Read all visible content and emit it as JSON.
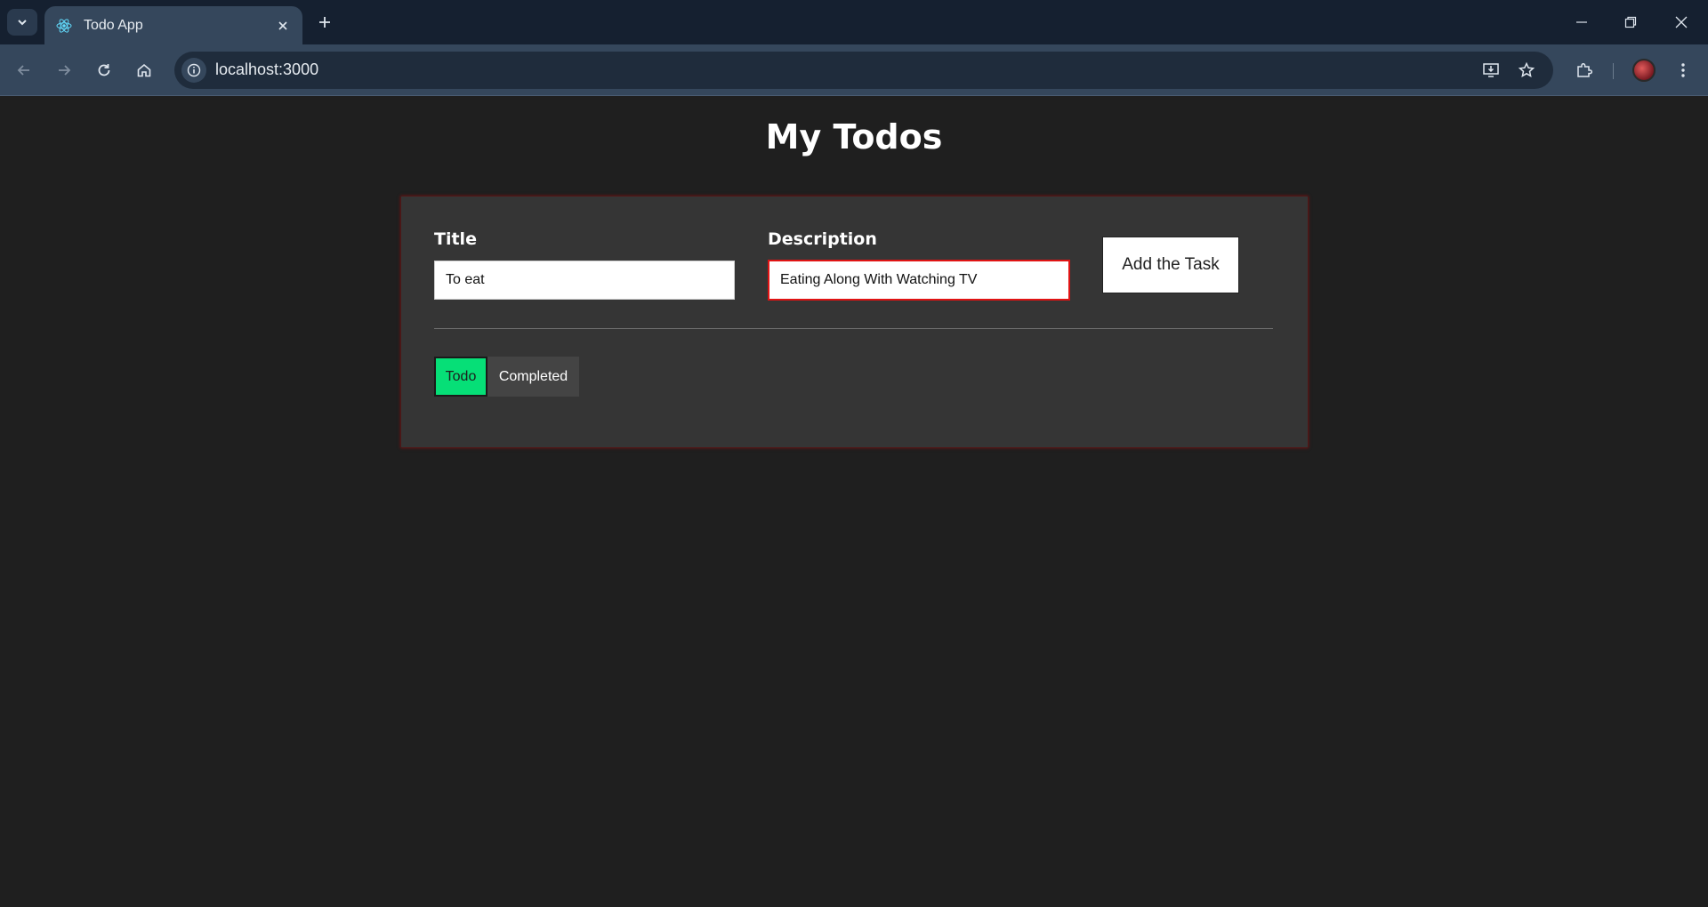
{
  "browser": {
    "tab_title": "Todo App",
    "url": "localhost:3000"
  },
  "page": {
    "heading": "My Todos",
    "title_label": "Title",
    "title_value": "To eat",
    "description_label": "Description",
    "description_value": "Eating Along With Watching TV",
    "add_button": "Add the Task",
    "filters": {
      "todo": "Todo",
      "completed": "Completed",
      "active": "Todo"
    }
  },
  "colors": {
    "background": "#1f1f1f",
    "card": "#353535",
    "active_filter": "#06df77",
    "focus_border": "#e01414"
  }
}
